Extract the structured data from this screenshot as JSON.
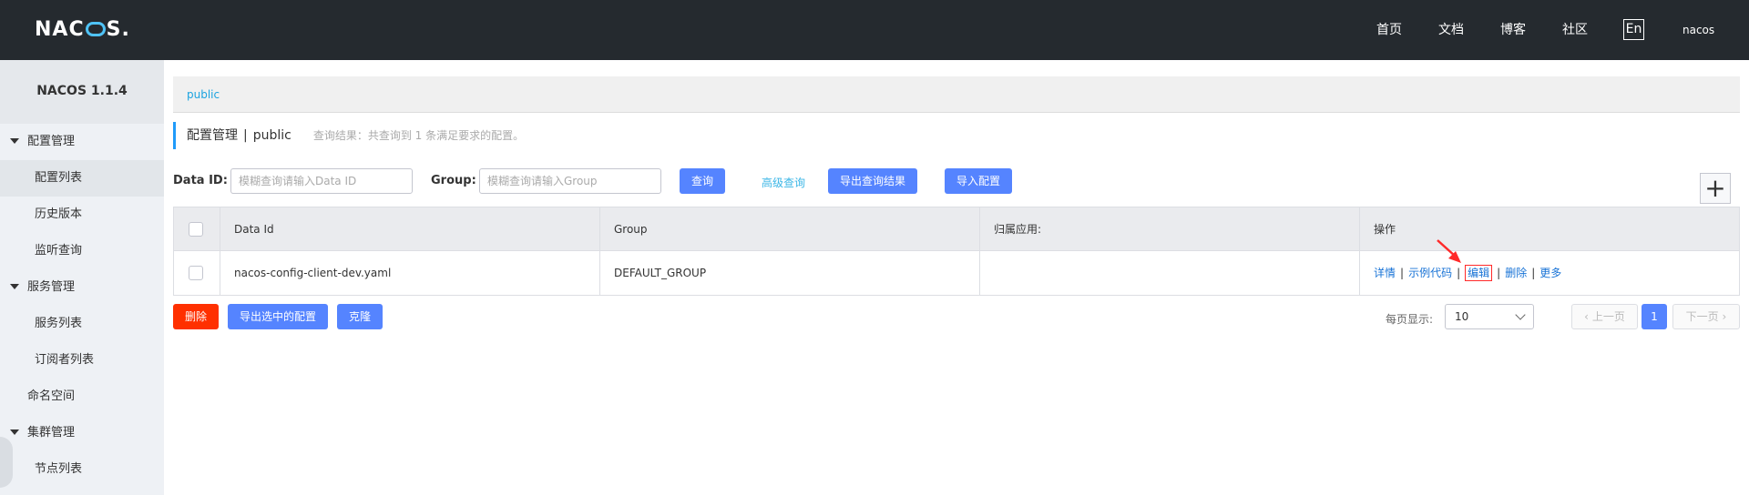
{
  "topbar": {
    "logo": "NACOS.",
    "nav": [
      "首页",
      "文档",
      "博客",
      "社区"
    ],
    "lang": "En",
    "user": "nacos"
  },
  "sidebar": {
    "title": "NACOS 1.1.4",
    "items": [
      {
        "label": "配置管理",
        "type": "group"
      },
      {
        "label": "配置列表",
        "type": "sub",
        "active": true
      },
      {
        "label": "历史版本",
        "type": "sub"
      },
      {
        "label": "监听查询",
        "type": "sub"
      },
      {
        "label": "服务管理",
        "type": "group"
      },
      {
        "label": "服务列表",
        "type": "sub"
      },
      {
        "label": "订阅者列表",
        "type": "sub"
      },
      {
        "label": "命名空间",
        "type": "top"
      },
      {
        "label": "集群管理",
        "type": "group"
      },
      {
        "label": "节点列表",
        "type": "sub"
      }
    ]
  },
  "breadcrumb": "public",
  "header": {
    "title": "配置管理",
    "separator": "|",
    "namespace": "public",
    "result": "查询结果：共查询到 1 条满足要求的配置。"
  },
  "search": {
    "dataid_label": "Data ID:",
    "dataid_placeholder": "模糊查询请输入Data ID",
    "group_label": "Group:",
    "group_placeholder": "模糊查询请输入Group",
    "query_button": "查询",
    "advanced_link": "高级查询",
    "export_button": "导出查询结果",
    "import_button": "导入配置",
    "add_button": "+"
  },
  "table": {
    "columns": [
      "Data Id",
      "Group",
      "归属应用:",
      "操作"
    ],
    "rows": [
      {
        "data_id": "nacos-config-client-dev.yaml",
        "group": "DEFAULT_GROUP",
        "app": ""
      }
    ],
    "operations": [
      "详情",
      "示例代码",
      "编辑",
      "删除",
      "更多"
    ],
    "highlighted_operation": "编辑"
  },
  "actions": {
    "delete": "删除",
    "export_selected": "导出选中的配置",
    "clone": "克隆"
  },
  "pagination": {
    "per_page_label": "每页显示:",
    "per_page_value": "10",
    "prev": "上一页",
    "next": "下一页",
    "current": "1"
  },
  "colors": {
    "topbar": "#252a2f",
    "primary": "#5584ff",
    "danger": "#ff3000",
    "link": "#1873d6",
    "highlight_box": "#ff2a2a"
  }
}
